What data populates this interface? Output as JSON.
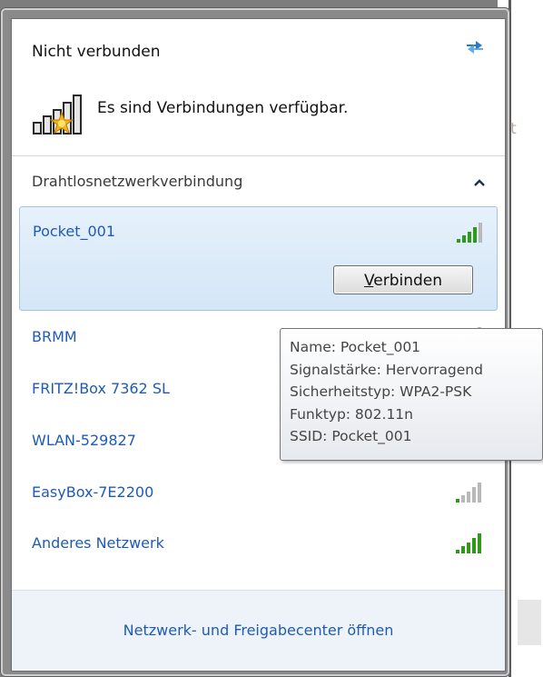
{
  "flyout": {
    "status": "Nicht verbunden",
    "available_text": "Es sind Verbindungen verfügbar.",
    "section_label": "Drahtlosnetzwerkverbindung",
    "selected_network": {
      "name": "Pocket_001",
      "connect_label_accesskey": "V",
      "connect_label_rest": "erbinden",
      "signal_level": 4
    },
    "networks": [
      {
        "name": "BRMM",
        "signal_level": 1
      },
      {
        "name": "FRITZ!Box 7362 SL",
        "signal_level": 0
      },
      {
        "name": "WLAN-529827",
        "signal_level": 0
      },
      {
        "name": "EasyBox-7E2200",
        "signal_level": 1
      },
      {
        "name": "Anderes Netzwerk",
        "signal_level": 5
      }
    ],
    "footer_link": "Netzwerk- und Freigabecenter öffnen"
  },
  "tooltip": {
    "lines": [
      "Name: Pocket_001",
      "Signalstärke: Hervorragend",
      "Sicherheitstyp: WPA2-PSK",
      "Funktyp: 802.11n",
      "SSID: Pocket_001"
    ]
  },
  "background": {
    "stray_char": "t"
  },
  "colors": {
    "link_blue": "#1f5bb6",
    "signal_green": "#2f9a1a",
    "signal_gray": "#b9b9b9",
    "selected_bg": "#dbeaf8"
  }
}
